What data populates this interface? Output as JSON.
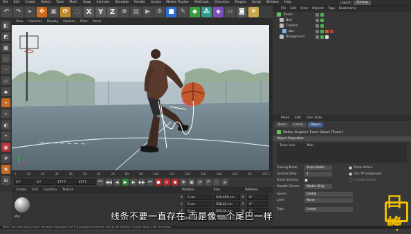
{
  "menubar": {
    "items": [
      "File",
      "Edit",
      "Create",
      "Select",
      "Tools",
      "Mesh",
      "Snap",
      "Animate",
      "Simulate",
      "Render",
      "Sculpt",
      "Motion Tracker",
      "MoGraph",
      "Character",
      "Plugins",
      "Script",
      "Window",
      "Help"
    ],
    "layout_label": "Layout:",
    "layout_value": "Startup"
  },
  "toolbar": {
    "buttons": [
      "undo-icon",
      "redo-icon",
      "select-icon",
      "move-icon",
      "scale-icon",
      "rotate-icon",
      "live-select-icon",
      "x-axis",
      "y-axis",
      "z-axis",
      "coord-icon",
      "render-view-icon",
      "render-icon",
      "render-settings-icon",
      "cube-icon",
      "pen-icon",
      "subdivide-icon",
      "array-icon",
      "deformer-icon",
      "floor-icon",
      "camera-icon",
      "light-icon"
    ],
    "x": "X",
    "y": "Y",
    "z": "Z"
  },
  "viewport": {
    "menu": [
      "View",
      "Cameras",
      "Display",
      "Options",
      "Filter",
      "Panel"
    ],
    "scroll_hint": "◂ ▸"
  },
  "timeline": {
    "ticks": [
      "0",
      "10",
      "20",
      "30",
      "40",
      "50",
      "60",
      "70",
      "80",
      "90",
      "100",
      "110",
      "120",
      "130",
      "140",
      "150",
      "16",
      "172 F"
    ]
  },
  "transport": {
    "start": "0 F",
    "current": "0 F",
    "end": "177 F",
    "end2": "177 F"
  },
  "material": {
    "menu": [
      "Create",
      "Edit",
      "Function",
      "Texture"
    ],
    "label": "Mat"
  },
  "coordinates": {
    "headers": [
      "Position",
      "Size",
      "Rotation"
    ],
    "rows": [
      {
        "axis": "X",
        "pos": "0 cm",
        "size": "240.458 cm",
        "rot": "H",
        "rot_val": "0°"
      },
      {
        "axis": "Y",
        "pos": "0 cm",
        "size": "258.42 cm",
        "rot": "P",
        "rot_val": "0°"
      },
      {
        "axis": "Z",
        "pos": "0 cm",
        "size": "265.34 cm",
        "rot": "B",
        "rot_val": "0°"
      }
    ],
    "apply": "Apply",
    "mode": "Object (Rel)"
  },
  "objects": {
    "menu": [
      "File",
      "Edit",
      "View",
      "Objects",
      "Tags",
      "Bookmarks"
    ],
    "items": [
      {
        "name": "Tracer",
        "color": "#5ec45e"
      },
      {
        "name": "Null",
        "color": "#bbbbbb"
      },
      {
        "name": "Camera",
        "color": "#bbbbbb"
      },
      {
        "name": "abc",
        "color": "#7ab7e8"
      },
      {
        "name": "Background",
        "color": "#bbbbbb"
      }
    ]
  },
  "attributes": {
    "menu": [
      "Mode",
      "Edit",
      "User Data"
    ],
    "tabs": [
      "Basic",
      "Coord.",
      "Object"
    ],
    "title": "Motion Graphics Tracer Object [Tracer]",
    "section": "Object Properties",
    "trace_link_label": "Trace Link",
    "trace_link_value": "Null",
    "rows": [
      {
        "k": "Tracing Mode",
        "v": "Trace Paths"
      },
      {
        "k": "Sample Step",
        "v": "1"
      },
      {
        "k": "Trace Vertices",
        "v": ""
      },
      {
        "k": "Handle Clones",
        "v": "Nodes Only"
      }
    ],
    "checks": [
      "Trace Active",
      "Use TP Subgroups",
      "Include Clones"
    ],
    "space_label": "Space",
    "space_value": "Global",
    "limit_label": "Limit",
    "limit_value": "None",
    "type_label": "Type",
    "type_value": "Linear"
  },
  "status": "Move: Click and drag to move elements. Hold down SHIFT to quantize movement / add to the selection in point mode, CTRL to remove.",
  "subtitle": "线条不要一直存在 而是像一个尾巴一样",
  "watermark": "口峰",
  "colors": {
    "accent": "#3f5e8c",
    "record": "#b42a2a",
    "play": "#2f7d3a"
  }
}
